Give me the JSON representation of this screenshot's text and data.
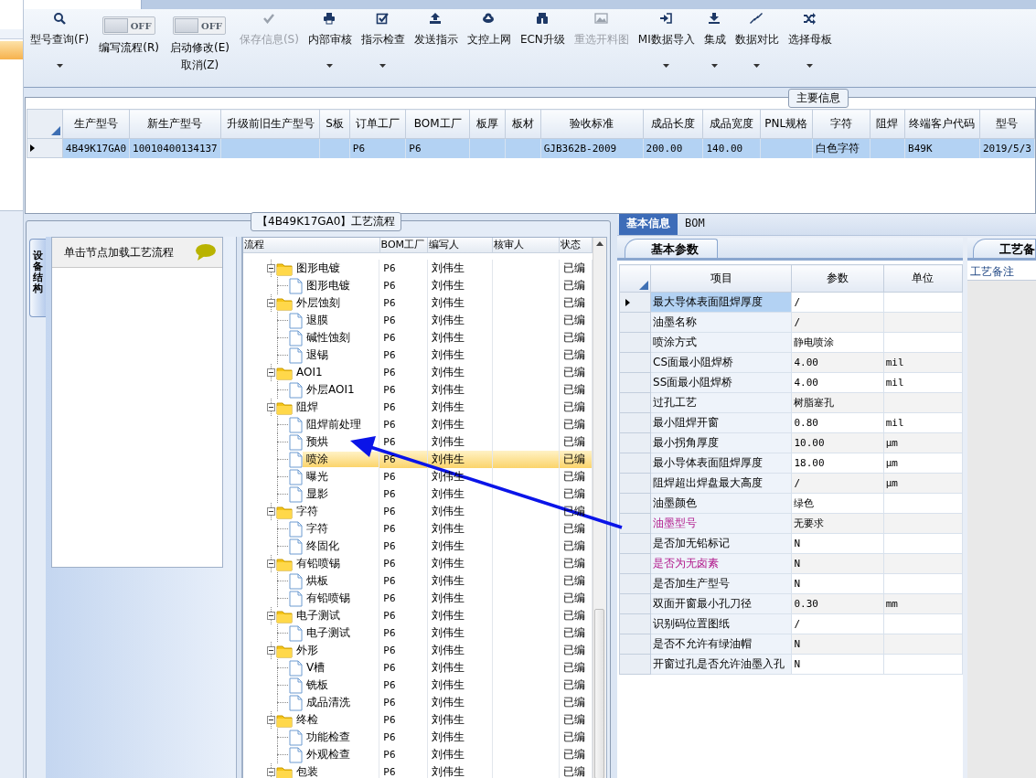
{
  "toolbar": {
    "items": [
      {
        "kind": "button",
        "label": "型号查询(F)",
        "menu": true,
        "disabled": false
      },
      {
        "kind": "toggle",
        "label": "编写流程(R)",
        "switch_text": "OFF",
        "on": false
      },
      {
        "kind": "toggle",
        "label": "启动修改(E)",
        "sublabel": "取消(Z)",
        "switch_text": "OFF",
        "on": false
      },
      {
        "kind": "button",
        "label": "保存信息(S)",
        "menu": false,
        "disabled": true
      },
      {
        "kind": "button",
        "label": "内部审核",
        "menu": true,
        "disabled": false
      },
      {
        "kind": "button",
        "label": "指示检查",
        "menu": true,
        "disabled": false
      },
      {
        "kind": "button",
        "label": "发送指示",
        "menu": false,
        "disabled": false
      },
      {
        "kind": "button",
        "label": "文控上网",
        "menu": false,
        "disabled": false
      },
      {
        "kind": "button",
        "label": "ECN升级",
        "menu": false,
        "disabled": false
      },
      {
        "kind": "button",
        "label": "重选开料图",
        "menu": false,
        "disabled": true
      },
      {
        "kind": "button",
        "label": "MI数据导入",
        "menu": true,
        "disabled": false
      },
      {
        "kind": "button",
        "label": "集成",
        "menu": true,
        "disabled": false
      },
      {
        "kind": "button",
        "label": "数据对比",
        "menu": true,
        "disabled": false
      },
      {
        "kind": "button",
        "label": "选择母板",
        "menu": true,
        "disabled": false
      }
    ]
  },
  "main_info": {
    "title": "主要信息",
    "columns": [
      "生产型号",
      "新生产型号",
      "升级前旧生产型号",
      "S板",
      "订单工厂",
      "BOM工厂",
      "板厚",
      "板材",
      "验收标准",
      "成品长度",
      "成品宽度",
      "PNL规格",
      "字符",
      "阻焊",
      "终端客户代码",
      "型号"
    ],
    "rows": [
      {
        "selected": true,
        "cells": [
          "4B49K17GA0",
          "10010400134137",
          null,
          null,
          "P6",
          "P6",
          null,
          null,
          "GJB362B-2009",
          "200.00",
          "140.00",
          null,
          "白色字符",
          null,
          "B49K",
          "2019/5/3"
        ]
      }
    ]
  },
  "flow": {
    "title": "【4B49K17GA0】工艺流程",
    "side_tab": "设备结构",
    "hint": "单击节点加载工艺流程",
    "columns": [
      "流程",
      "BOM工厂",
      "编写人",
      "核审人",
      "状态"
    ],
    "tree": [
      {
        "label": "图形电镀",
        "bom": "P6",
        "writer": "刘伟生",
        "status": "已编",
        "selected": false,
        "expanded": true,
        "children": [
          {
            "label": "图形电镀",
            "bom": "P6",
            "writer": "刘伟生",
            "status": "已编",
            "selected": false
          }
        ]
      },
      {
        "label": "外层蚀刻",
        "bom": "P6",
        "writer": "刘伟生",
        "status": "已编",
        "selected": false,
        "expanded": true,
        "children": [
          {
            "label": "退膜",
            "bom": "P6",
            "writer": "刘伟生",
            "status": "已编",
            "selected": false
          },
          {
            "label": "碱性蚀刻",
            "bom": "P6",
            "writer": "刘伟生",
            "status": "已编",
            "selected": false
          },
          {
            "label": "退锡",
            "bom": "P6",
            "writer": "刘伟生",
            "status": "已编",
            "selected": false
          }
        ]
      },
      {
        "label": "AOI1",
        "bom": "P6",
        "writer": "刘伟生",
        "status": "已编",
        "selected": false,
        "expanded": true,
        "children": [
          {
            "label": "外层AOI1",
            "bom": "P6",
            "writer": "刘伟生",
            "status": "已编",
            "selected": false
          }
        ]
      },
      {
        "label": "阻焊",
        "bom": "P6",
        "writer": "刘伟生",
        "status": "已编",
        "selected": false,
        "expanded": true,
        "children": [
          {
            "label": "阻焊前处理",
            "bom": "P6",
            "writer": "刘伟生",
            "status": "已编",
            "selected": false
          },
          {
            "label": "预烘",
            "bom": "P6",
            "writer": "刘伟生",
            "status": "已编",
            "selected": false
          },
          {
            "label": "喷涂",
            "bom": "P6",
            "writer": "刘伟生",
            "status": "已编",
            "selected": true
          },
          {
            "label": "曝光",
            "bom": "P6",
            "writer": "刘伟生",
            "status": "已编",
            "selected": false
          },
          {
            "label": "显影",
            "bom": "P6",
            "writer": "刘伟生",
            "status": "已编",
            "selected": false
          }
        ]
      },
      {
        "label": "字符",
        "bom": "P6",
        "writer": "刘伟生",
        "status": "已编",
        "selected": false,
        "expanded": true,
        "children": [
          {
            "label": "字符",
            "bom": "P6",
            "writer": "刘伟生",
            "status": "已编",
            "selected": false
          },
          {
            "label": "终固化",
            "bom": "P6",
            "writer": "刘伟生",
            "status": "已编",
            "selected": false
          }
        ]
      },
      {
        "label": "有铅喷锡",
        "bom": "P6",
        "writer": "刘伟生",
        "status": "已编",
        "selected": false,
        "expanded": true,
        "children": [
          {
            "label": "烘板",
            "bom": "P6",
            "writer": "刘伟生",
            "status": "已编",
            "selected": false
          },
          {
            "label": "有铅喷锡",
            "bom": "P6",
            "writer": "刘伟生",
            "status": "已编",
            "selected": false
          }
        ]
      },
      {
        "label": "电子测试",
        "bom": "P6",
        "writer": "刘伟生",
        "status": "已编",
        "selected": false,
        "expanded": true,
        "children": [
          {
            "label": "电子测试",
            "bom": "P6",
            "writer": "刘伟生",
            "status": "已编",
            "selected": false
          }
        ]
      },
      {
        "label": "外形",
        "bom": "P6",
        "writer": "刘伟生",
        "status": "已编",
        "selected": false,
        "expanded": true,
        "children": [
          {
            "label": "V槽",
            "bom": "P6",
            "writer": "刘伟生",
            "status": "已编",
            "selected": false
          },
          {
            "label": "铣板",
            "bom": "P6",
            "writer": "刘伟生",
            "status": "已编",
            "selected": false
          },
          {
            "label": "成品清洗",
            "bom": "P6",
            "writer": "刘伟生",
            "status": "已编",
            "selected": false
          }
        ]
      },
      {
        "label": "终检",
        "bom": "P6",
        "writer": "刘伟生",
        "status": "已编",
        "selected": false,
        "expanded": true,
        "children": [
          {
            "label": "功能检查",
            "bom": "P6",
            "writer": "刘伟生",
            "status": "已编",
            "selected": false
          },
          {
            "label": "外观检查",
            "bom": "P6",
            "writer": "刘伟生",
            "status": "已编",
            "selected": false
          }
        ]
      },
      {
        "label": "包装",
        "bom": "P6",
        "writer": "刘伟生",
        "status": "已编",
        "selected": false,
        "expanded": true
      }
    ]
  },
  "params": {
    "tabs": [
      {
        "label": "基本信息",
        "selected": true
      },
      {
        "label": "BOM",
        "selected": false
      }
    ],
    "subtab": "基本参数",
    "columns": [
      "项目",
      "参数",
      "单位"
    ],
    "rows": [
      {
        "item": "最大导体表面阻焊厚度",
        "value": "/",
        "selected": true,
        "flagged": false
      },
      {
        "item": "油墨名称",
        "value": "/",
        "selected": false,
        "flagged": false
      },
      {
        "item": "喷涂方式",
        "value": "静电喷涂",
        "selected": false,
        "flagged": false
      },
      {
        "item": "CS面最小阻焊桥",
        "value": "4.00",
        "unit": "mil",
        "selected": false,
        "flagged": false
      },
      {
        "item": "SS面最小阻焊桥",
        "value": "4.00",
        "unit": "mil",
        "selected": false,
        "flagged": false
      },
      {
        "item": "过孔工艺",
        "value": "树脂塞孔",
        "selected": false,
        "flagged": false
      },
      {
        "item": "最小阻焊开窗",
        "value": "0.80",
        "unit": "mil",
        "selected": false,
        "flagged": false
      },
      {
        "item": "最小拐角厚度",
        "value": "10.00",
        "unit": "μm",
        "selected": false,
        "flagged": false
      },
      {
        "item": "最小导体表面阻焊厚度",
        "value": "18.00",
        "unit": "μm",
        "selected": false,
        "flagged": false
      },
      {
        "item": "阻焊超出焊盘最大高度",
        "value": "/",
        "unit": "μm",
        "selected": false,
        "flagged": false
      },
      {
        "item": "油墨颜色",
        "value": "绿色",
        "selected": false,
        "flagged": false
      },
      {
        "item": "油墨型号",
        "value": "无要求",
        "selected": false,
        "flagged": true
      },
      {
        "item": "是否加无铅标记",
        "value": "N",
        "selected": false,
        "flagged": false
      },
      {
        "item": "是否为无卤素",
        "value": "N",
        "selected": false,
        "flagged": true
      },
      {
        "item": "是否加生产型号",
        "value": "N",
        "selected": false,
        "flagged": false
      },
      {
        "item": "双面开窗最小孔刀径",
        "value": "0.30",
        "unit": "mm",
        "selected": false,
        "flagged": false
      },
      {
        "item": "识别码位置图纸",
        "value": "/",
        "selected": false,
        "flagged": false
      },
      {
        "item": "是否不允许有绿油帽",
        "value": "N",
        "selected": false,
        "flagged": false
      },
      {
        "item": "开窗过孔是否允许油墨入孔",
        "value": "N",
        "selected": false,
        "flagged": false
      }
    ],
    "notes_tab": "工艺备",
    "notes_label": "工艺备注"
  }
}
